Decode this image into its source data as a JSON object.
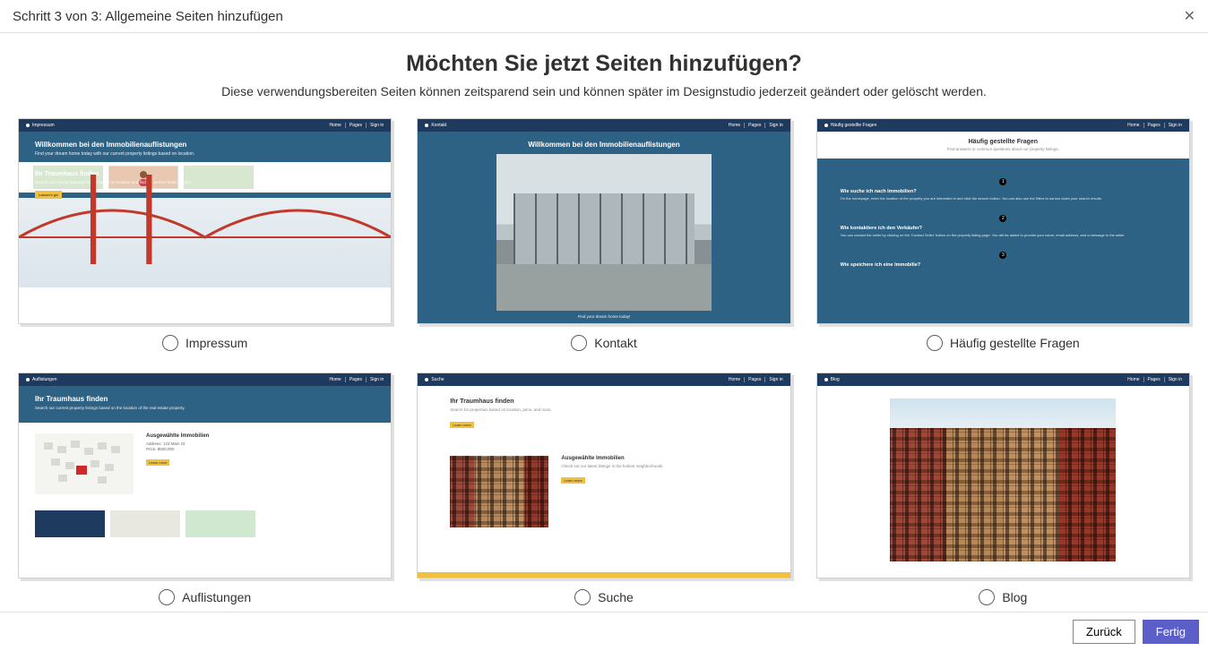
{
  "header": {
    "title": "Schritt 3 von 3: Allgemeine Seiten hinzufügen",
    "close": "✕"
  },
  "heading": "Möchten Sie jetzt Seiten hinzufügen?",
  "subheading": "Diese verwendungsbereiten Seiten können zeitsparend sein und können später im Designstudio jederzeit geändert oder gelöscht werden.",
  "nav": {
    "home": "Home",
    "pages": "Pages",
    "signin": "Sign in"
  },
  "cards": {
    "impressum": {
      "title": "Impressum",
      "hero_h": "Willkommen bei den Immobilienauflistungen",
      "hero_p": "Find your dream home today with our current property listings based on location.",
      "sec_h": "Ihr Traumhaus finden",
      "sec_p": "Search our current property listings based on location and find the perfect home for you.",
      "btn": "Lassen's go!"
    },
    "kontakt": {
      "title": "Kontakt",
      "hero_h": "Willkommen bei den Immobilienauflistungen",
      "caption": "Find your dream home today!"
    },
    "faq": {
      "title": "Häufig gestellte Fragen",
      "top_h": "Häufig gestellte Fragen",
      "top_p": "Find answers to common questions about our property listings.",
      "q1_h": "Wie suche ich nach Immobilien?",
      "q1_p": "On the homepage, enter the location of the property you are interested in and click the search button. You can also use the filters to narrow down your search results.",
      "q2_h": "Wie kontaktiere ich den Verkäufer?",
      "q2_p": "You can contact the seller by clicking on the 'Contact Seller' button on the property listing page. You will be asked to provide your name, email address, and a message to the seller.",
      "q3_h": "Wie speichere ich eine Immobilie?"
    },
    "auflistungen": {
      "title": "Auflistungen",
      "hero_h": "Ihr Traumhaus finden",
      "hero_p": "Search our current property listings based on the location of the real estate property.",
      "item_h": "Ausgewählte Immobilien",
      "addr": "Address: 123 Main St",
      "price": "Price: $500,000",
      "btn": "Learn more"
    },
    "suche": {
      "title": "Suche",
      "hero_h": "Ihr Traumhaus finden",
      "hero_p": "Search for properties based on location, price, and more.",
      "btn1": "Learn more",
      "item_h": "Ausgewählte Immobilien",
      "item_p": "Check out our latest listings in the hottest neighborhoods.",
      "btn2": "Learn more"
    },
    "blog": {
      "title": "Blog"
    }
  },
  "footer": {
    "back": "Zurück",
    "done": "Fertig"
  }
}
